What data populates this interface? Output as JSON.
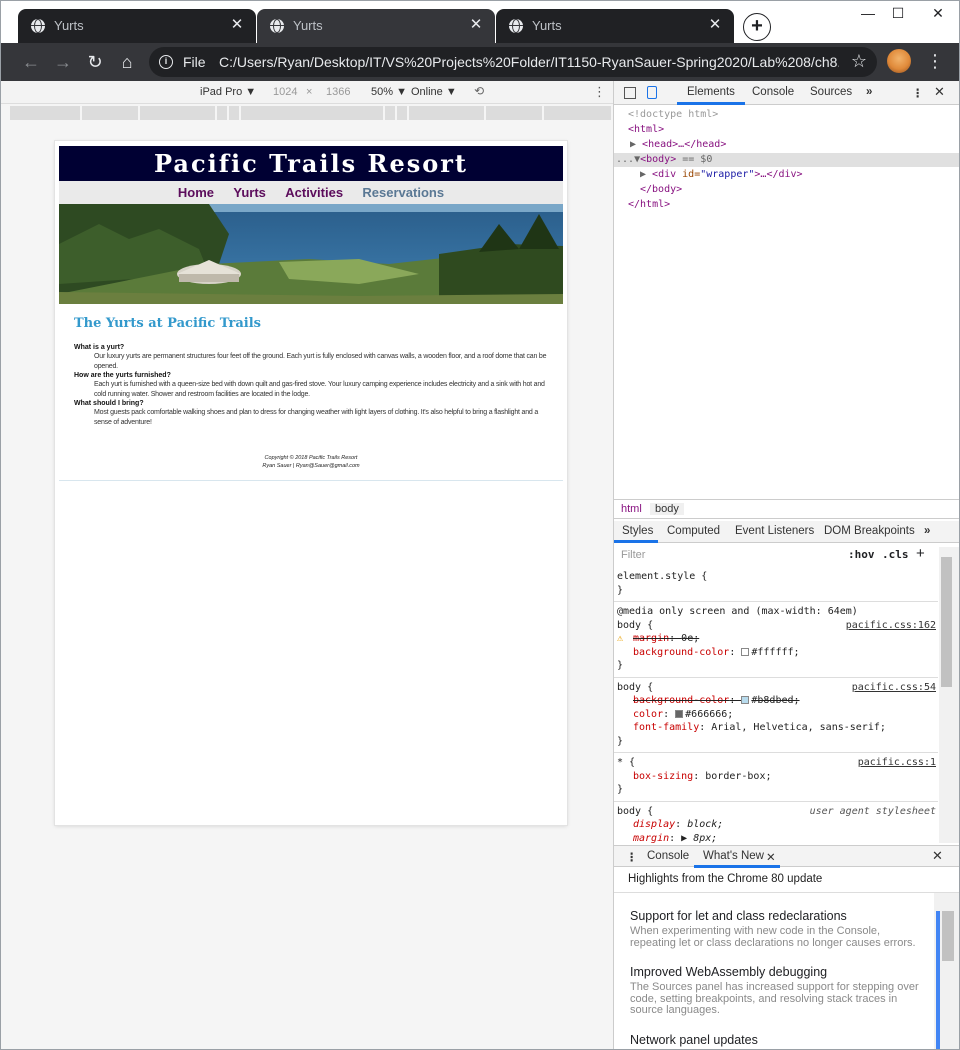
{
  "browser": {
    "tabs": [
      {
        "title": "Yurts"
      },
      {
        "title": "Yurts"
      },
      {
        "title": "Yurts"
      }
    ],
    "tab_close_glyph": "✕",
    "new_tab_glyph": "+",
    "window_controls": {
      "minimize": "—",
      "maximize": "☐",
      "close": "✕"
    },
    "nav": {
      "back": "←",
      "forward": "→",
      "reload": "↻",
      "home": "⌂"
    },
    "address": {
      "scheme_label": "File",
      "url": "C:/Users/Ryan/Desktop/IT/VS%20Projects%20Folder/IT1150-RyanSauer-Spring2020/Lab%208/ch8..."
    },
    "bookmark_glyph": "☆",
    "menu_glyph": "⋮"
  },
  "device_toolbar": {
    "device": "iPad Pro ▼",
    "width": "1024",
    "times": "×",
    "height": "1366",
    "zoom": "50% ▼",
    "throttle": "Online ▼",
    "rotate_glyph": "⟲",
    "more_glyph": "⋮"
  },
  "site": {
    "header": "Pacific Trails Resort",
    "nav": [
      "Home",
      "Yurts",
      "Activities",
      "Reservations"
    ],
    "page_title": "The Yurts at Pacific Trails",
    "faq": [
      {
        "q": "What is a yurt?",
        "a": "Our luxury yurts are permanent structures four feet off the ground. Each yurt is fully enclosed with canvas walls, a wooden floor, and a roof dome that can be opened."
      },
      {
        "q": "How are the yurts furnished?",
        "a": "Each yurt is furnished with a queen-size bed with down quilt and gas-fired stove. Your luxury camping experience includes electricity and a sink with hot and cold running water. Shower and restroom facilities are located in the lodge."
      },
      {
        "q": "What should I bring?",
        "a": "Most guests pack comfortable walking shoes and plan to dress for changing weather with light layers of clothing. It's also helpful to bring a flashlight and a sense of adventure!"
      }
    ],
    "copyright": "Copyright © 2018 Pacific Trails Resort",
    "email": "Ryan Sauer | Ryan@Sauer@gmail.com"
  },
  "devtools": {
    "tabs": {
      "elements": "Elements",
      "console": "Console",
      "sources": "Sources",
      "more": "»",
      "kebab": "⋮",
      "close": "✕"
    },
    "dom": {
      "doctype": "<!doctype html>",
      "html_open": "<html>",
      "head": "<head>…</head>",
      "body_prefix": "...",
      "body_open": "<body>",
      "body_eq": "== $0",
      "div_tag": "<div ",
      "div_attr_name": "id=",
      "div_attr_value": "\"wrapper\"",
      "div_rest": ">…</div>",
      "body_close": "</body>",
      "html_close": "</html>"
    },
    "breadcrumbs": [
      "html",
      "body"
    ],
    "styles_tabs": {
      "styles": "Styles",
      "computed": "Computed",
      "listeners": "Event Listeners",
      "breakpoints": "DOM Breakpoints",
      "more": "»"
    },
    "filter": {
      "placeholder": "Filter",
      "hov": ":hov",
      "cls": ".cls",
      "add": "+"
    },
    "rules": {
      "element_style": "element.style {",
      "close": "}",
      "media_query": "@media only screen and (max-width: 64em)",
      "r1": {
        "selector": "body {",
        "source": "pacific.css:162",
        "p1_name": "margin",
        "p1_value": "0e;",
        "p2_name": "background-color",
        "p2_value": "#ffffff;",
        "p2_color": "#ffffff"
      },
      "r2": {
        "selector": "body {",
        "source": "pacific.css:54",
        "p1_name": "background-color",
        "p1_value": "#b8dbed;",
        "p1_color": "#b8dbed",
        "p2_name": "color",
        "p2_value": "#666666;",
        "p2_color": "#666666",
        "p3_name": "font-family",
        "p3_value": "Arial, Helvetica, sans-serif;"
      },
      "r3": {
        "selector": "* {",
        "source": "pacific.css:1",
        "p1_name": "box-sizing",
        "p1_value": "border-box;"
      },
      "r4": {
        "selector": "body {",
        "source": "user agent stylesheet",
        "p1_name": "display",
        "p1_value": "block;",
        "p2_name": "margin",
        "p2_value": "▶ 8px;"
      }
    },
    "drawer": {
      "kebab": "⋮",
      "console": "Console",
      "whats_new": "What's New",
      "whats_new_close": "✕",
      "close": "✕",
      "highlights": "Highlights from the Chrome 80 update",
      "news": [
        {
          "title": "Support for let and class redeclarations",
          "desc": "When experimenting with new code in the Console, repeating let or class declarations no longer causes errors."
        },
        {
          "title": "Improved WebAssembly debugging",
          "desc": "The Sources panel has increased support for stepping over code, setting breakpoints, and resolving stack traces in source languages."
        },
        {
          "title": "Network panel updates",
          "desc": ""
        }
      ]
    }
  }
}
